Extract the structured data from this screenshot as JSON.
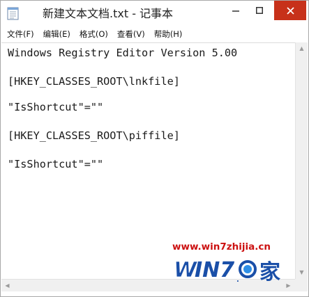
{
  "window": {
    "title": "新建文本文档.txt - 记事本",
    "controls": {
      "minimize": "—",
      "maximize": "☐",
      "close": "✕"
    },
    "icon": "notepad-icon"
  },
  "menu": {
    "items": [
      {
        "label": "文件(F)"
      },
      {
        "label": "编辑(E)"
      },
      {
        "label": "格式(O)"
      },
      {
        "label": "查看(V)"
      },
      {
        "label": "帮助(H)"
      }
    ]
  },
  "editor": {
    "lines": [
      "Windows Registry Editor Version 5.00",
      "[HKEY_CLASSES_ROOT\\lnkfile]",
      "\"IsShortcut\"=\"\"",
      "[HKEY_CLASSES_ROOT\\piffile]",
      "\"IsShortcut\"=\"\""
    ]
  },
  "watermark": {
    "url": "www.win7zhijia.cn",
    "logo_text": "WIN7",
    "logo_suffix": "家"
  },
  "colors": {
    "close_button": "#c7311a",
    "watermark_red": "#cc1111",
    "watermark_blue": "#1a4fa8"
  }
}
